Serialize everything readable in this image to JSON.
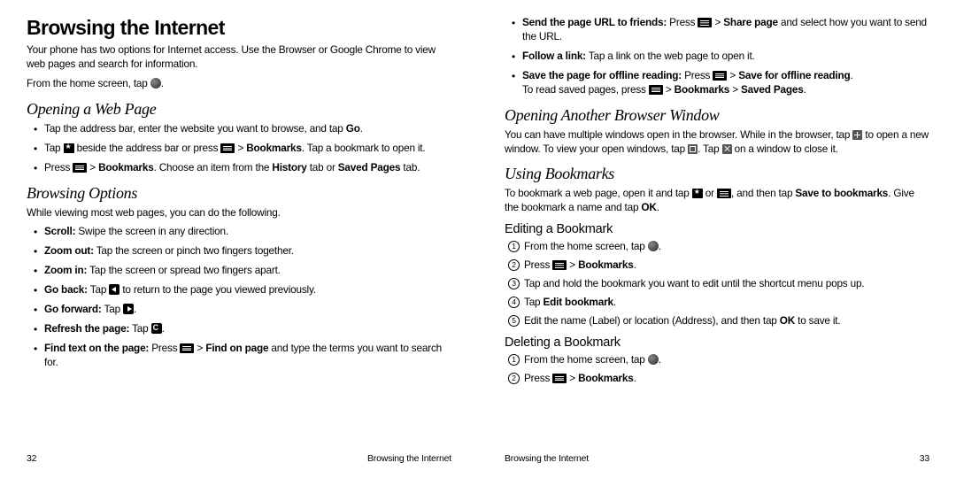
{
  "left": {
    "title": "Browsing the Internet",
    "intro": "Your phone has two options for Internet access. Use the Browser or Google Chrome to view web pages and search for information.",
    "from_home_a": "From the home screen, tap ",
    "from_home_b": ".",
    "h_open": "Opening a Web Page",
    "open1_a": "Tap the address bar, enter the website you want to browse, and tap ",
    "open1_go": "Go",
    "open1_b": ".",
    "open2_a": "Tap ",
    "open2_b": " beside the address bar or press ",
    "open2_c": " > ",
    "open2_bm": "Bookmarks",
    "open2_d": ". Tap a bookmark to open it.",
    "open3_a": "Press ",
    "open3_b": " > ",
    "open3_bm": "Bookmarks",
    "open3_c": ". Choose an item from the ",
    "open3_hist": "History",
    "open3_d": " tab or ",
    "open3_saved": "Saved Pages",
    "open3_e": " tab.",
    "h_browse": "Browsing Options",
    "browse_intro": "While viewing most web pages, you can do the following.",
    "b_scroll_l": "Scroll:",
    "b_scroll_t": " Swipe the screen in any direction.",
    "b_zo_l": "Zoom out:",
    "b_zo_t": " Tap the screen or pinch two fingers together.",
    "b_zi_l": "Zoom in:",
    "b_zi_t": " Tap the screen or spread two fingers apart.",
    "b_back_l": "Go back:",
    "b_back_a": " Tap ",
    "b_back_b": " to return to the page you viewed previously.",
    "b_fwd_l": "Go forward:",
    "b_fwd_a": " Tap ",
    "b_fwd_b": ".",
    "b_ref_l": "Refresh the page:",
    "b_ref_a": " Tap ",
    "b_ref_b": ".",
    "b_find_l": "Find text on the page:",
    "b_find_a": " Press ",
    "b_find_b": " > ",
    "b_find_fop": "Find on page",
    "b_find_c": " and type the terms you want to search for.",
    "pg": "32",
    "foot": "Browsing the Internet"
  },
  "right": {
    "send_l": "Send the page URL to friends:",
    "send_a": " Press ",
    "send_b": " > ",
    "send_sp": "Share page",
    "send_c": " and select how you want to send the URL.",
    "follow_l": "Follow a link:",
    "follow_t": " Tap a link on the web page to open it.",
    "save_l": "Save the page for offline reading:",
    "save_a": " Press ",
    "save_b": " > ",
    "save_so": "Save for offline reading",
    "save_c": ".",
    "save_sub_a": "To read saved pages, press ",
    "save_sub_b": " > ",
    "save_sub_bm": "Bookmarks",
    "save_sub_c": " > ",
    "save_sub_sp": "Saved Pages",
    "save_sub_d": ".",
    "h_another": "Opening Another Browser Window",
    "another_a": "You can have multiple windows open in the browser. While in the browser, tap ",
    "another_b": " to open a new window. To view your open windows, tap ",
    "another_c": ". Tap ",
    "another_d": " on a window to close it.",
    "h_bm": "Using Bookmarks",
    "bm_intro_a": "To bookmark a web page, open it and tap ",
    "bm_intro_b": " or ",
    "bm_intro_c": ", and then tap ",
    "bm_intro_save": "Save to bookmarks",
    "bm_intro_d": ". Give the bookmark a name and tap ",
    "bm_intro_ok": "OK",
    "bm_intro_e": ".",
    "h_edit": "Editing a Bookmark",
    "e1_a": "From the home screen, tap ",
    "e1_b": ".",
    "e2_a": "Press ",
    "e2_b": " > ",
    "e2_bm": "Bookmarks",
    "e2_c": ".",
    "e3": "Tap and hold the bookmark you want to edit until the shortcut menu pops up.",
    "e4_a": "Tap ",
    "e4_eb": "Edit bookmark",
    "e4_b": ".",
    "e5_a": "Edit the name (Label) or location (Address), and then tap ",
    "e5_ok": "OK",
    "e5_b": " to save it.",
    "h_del": "Deleting a Bookmark",
    "d1_a": "From the home screen, tap ",
    "d1_b": ".",
    "d2_a": "Press ",
    "d2_b": " > ",
    "d2_bm": "Bookmarks",
    "d2_c": ".",
    "foot": "Browsing the Internet",
    "pg": "33"
  }
}
